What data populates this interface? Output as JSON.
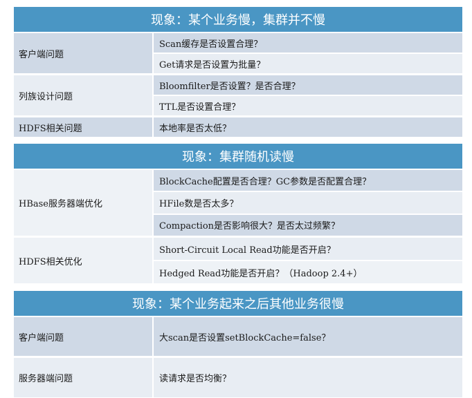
{
  "sections": [
    {
      "title": "现象：某个业务慢，集群并不慢",
      "groups": [
        {
          "label": "客户端问题",
          "items": [
            "Scan缓存是否设置合理？",
            "Get请求是否设置为批量？"
          ]
        },
        {
          "label": "列族设计问题",
          "items": [
            "Bloomfilter是否设置？是否合理？",
            "TTL是否设置合理？"
          ]
        },
        {
          "label": "HDFS相关问题",
          "items": [
            "本地率是否太低？"
          ]
        }
      ]
    },
    {
      "title": "现象：集群随机读慢",
      "groups": [
        {
          "label": "HBase服务器端优化",
          "items": [
            "BlockCache配置是否合理？GC参数是否配置合理？",
            "HFile数是否太多？",
            "Compaction是否影响很大？是否太过频繁？"
          ]
        },
        {
          "label": "HDFS相关优化",
          "items": [
            "Short-Circuit Local Read功能是否开启？",
            "Hedged Read功能是否开启？（Hadoop 2.4+）"
          ]
        }
      ]
    },
    {
      "title": "现象：某个业务起来之后其他业务很慢",
      "groups": [
        {
          "label": "客户端问题",
          "items": [
            "大scan是否设置setBlockCache=false？"
          ]
        },
        {
          "label": "服务器端问题",
          "items": [
            "读请求是否均衡？"
          ]
        }
      ]
    }
  ]
}
